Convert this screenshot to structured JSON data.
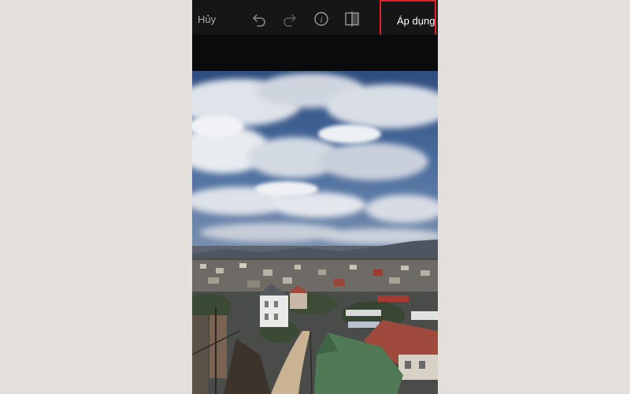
{
  "toolbar": {
    "cancel_label": "Hủy",
    "apply_label": "Áp dụng"
  },
  "icons": {
    "undo": "undo-icon",
    "redo": "redo-icon",
    "info": "info-icon",
    "compare": "compare-icon"
  },
  "colors": {
    "page_background": "#e3e0dc",
    "toolbar_background": "#161616",
    "highlight_border": "#e2202c"
  }
}
